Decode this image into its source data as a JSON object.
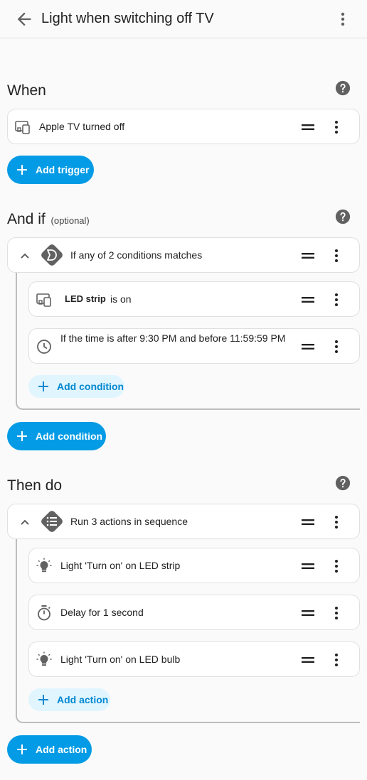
{
  "header": {
    "title": "Light when switching off TV"
  },
  "when": {
    "title": "When",
    "triggers": [
      {
        "label": "Apple TV turned off",
        "icon": "tv-device-icon"
      }
    ],
    "add_label": "Add trigger"
  },
  "and_if": {
    "title": "And if",
    "optional_label": "(optional)",
    "group_label": "If any of 2 conditions matches",
    "conditions": [
      {
        "entity": "LED strip",
        "state": "is on",
        "icon": "tv-device-icon"
      },
      {
        "label": "If the time is after 9:30 PM and before 11:59:59 PM",
        "icon": "clock-icon"
      }
    ],
    "inner_add_label": "Add condition",
    "add_label": "Add condition"
  },
  "then_do": {
    "title": "Then do",
    "group_label": "Run 3 actions in sequence",
    "actions": [
      {
        "label": "Light 'Turn on' on LED strip",
        "icon": "lightbulb-icon"
      },
      {
        "label": "Delay for 1 second",
        "icon": "timer-icon"
      },
      {
        "label": "Light 'Turn on' on LED bulb",
        "icon": "lightbulb-icon"
      }
    ],
    "inner_add_label": "Add action",
    "add_label": "Add action"
  },
  "colors": {
    "accent": "#039be5",
    "accent_soft": "#e1f5fe",
    "icon_dark": "#616161"
  }
}
